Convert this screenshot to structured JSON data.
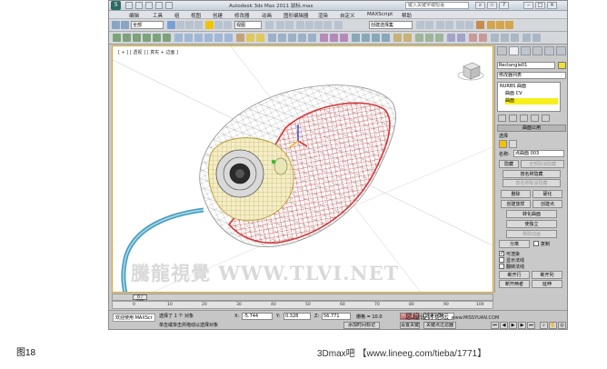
{
  "window": {
    "title": "Autodesk 3ds Max  2011     鼠标.max",
    "search_placeholder": "键入关键字或短语"
  },
  "menu": {
    "items": [
      "编辑",
      "工具",
      "组",
      "视图",
      "创建",
      "修改器",
      "动画",
      "图形编辑器",
      "渲染",
      "自定义",
      "MAXScript",
      "帮助"
    ]
  },
  "toolbar": {
    "selection_filter": "全部",
    "ref_coord": "视图",
    "named_selection": "创建选择集"
  },
  "viewport": {
    "label": "[ + ] [ 透视 ] [ 真实 + 边面 ]",
    "watermark": "騰龍視覺 WWW.TLVI.NET"
  },
  "command_panel": {
    "object_name": "Rectangle01",
    "modifier_list": "修改器列表",
    "stack": [
      "NURBS 曲面",
      "曲面 CV",
      "曲面"
    ],
    "rollout_title": "曲面公用",
    "selection_group": "选择",
    "name_label": "名称:",
    "name_value": "点曲面 003",
    "buttons": {
      "hide": "隐藏",
      "unhide_all": "全部取消隐藏",
      "hide_by_name": "按名称隐藏",
      "unhide_by_name": "按名称取消隐藏",
      "delete": "删除",
      "make_rigid": "硬化",
      "create_loft": "创建放样",
      "create_points": "创建点",
      "convert_surface": "转化曲面",
      "detach": "分离",
      "copy_label": "复制",
      "make_independent": "使独立",
      "remove_animation": "移除动画",
      "break_row": "断开行",
      "break_col": "断开列",
      "break_both": "断开两者",
      "extend": "延伸",
      "join": "连接",
      "selected_info": "选择面曲面 (0)"
    },
    "checkboxes": [
      {
        "label": "可渲染",
        "checked": true
      },
      {
        "label": "显示法线",
        "checked": false
      },
      {
        "label": "翻转法线",
        "checked": false
      }
    ]
  },
  "timeline": {
    "slider_label": "0 / 100",
    "ticks": [
      "0",
      "10",
      "20",
      "30",
      "40",
      "50",
      "60",
      "70",
      "80",
      "90",
      "100"
    ]
  },
  "status": {
    "selection_count": "选择了 1 个 对象",
    "prompt": "单击或单击并拖动以选择对象",
    "x_label": "X:",
    "x_value": "-5.744",
    "y_label": "Y:",
    "y_value": "0.328",
    "z_label": "Z:",
    "z_value": "56.771",
    "grid": "栅格 = 10.0",
    "auto_key": "自动关键点",
    "set_key": "设置关键点",
    "key_filters": "关键点过滤器",
    "selected_option": "选定对象",
    "add_time_tag": "添加时间标记",
    "welcome": "欢迎使用 MAXScr"
  },
  "overlay": {
    "forum_logo": "思缘设计论坛",
    "forum_url": "www.MISSYUAN.COM"
  },
  "caption": {
    "figure": "图18",
    "source": "3Dmax吧 【www.lineeg.com/tieba/1771】"
  }
}
